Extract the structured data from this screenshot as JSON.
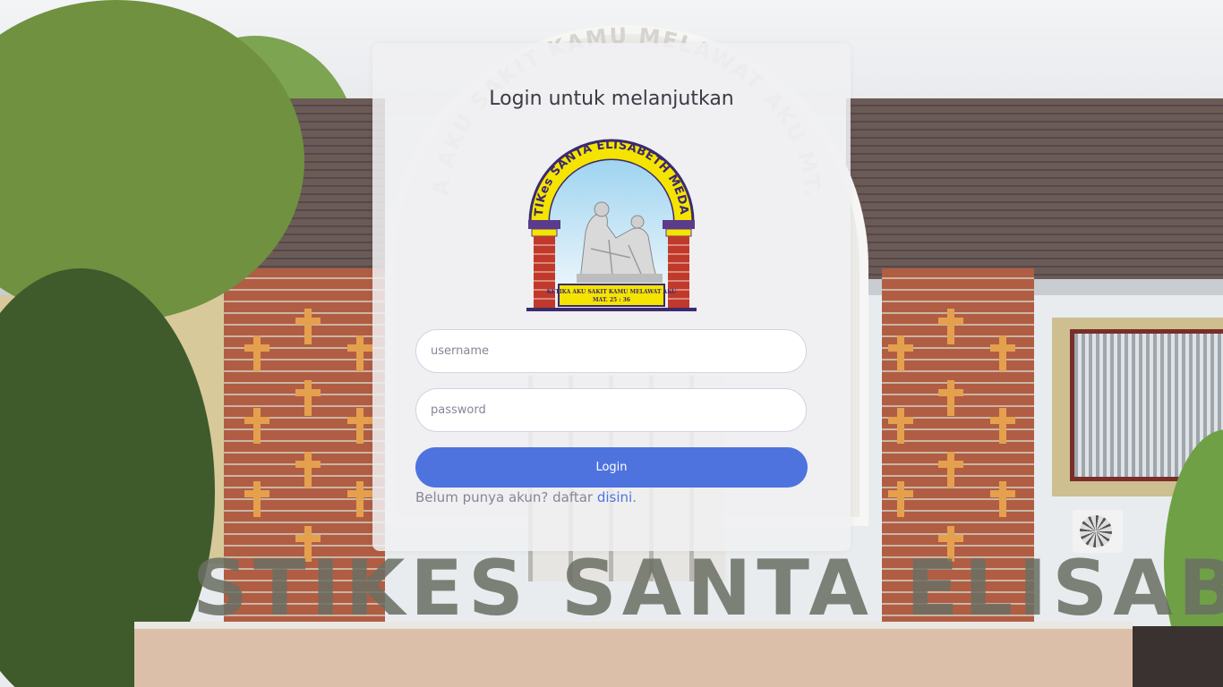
{
  "login": {
    "title": "Login untuk melanjutkan",
    "username_placeholder": "username",
    "password_placeholder": "password",
    "login_label": "Login",
    "signup_prompt": "Belum punya akun? daftar ",
    "signup_link": "disini",
    "signup_suffix": "."
  },
  "logo": {
    "arch_text": "STIKes SANTA ELISABETH MEDAN",
    "plaque_line1": "KETIKA AKU SAKIT KAMU MELAWAT AKU",
    "plaque_line2": "MAT. 25 : 36"
  },
  "background": {
    "arch_text": "KETIKA AKU SAKIT KAMU MELAWAT AKU MT.25.36",
    "sign_text": "STIKES SANTA ELISABETH"
  },
  "colors": {
    "primary": "#4e73df",
    "logo_yellow": "#f5e400",
    "logo_purple": "#3b2a6e",
    "logo_brick": "#c0392b"
  }
}
